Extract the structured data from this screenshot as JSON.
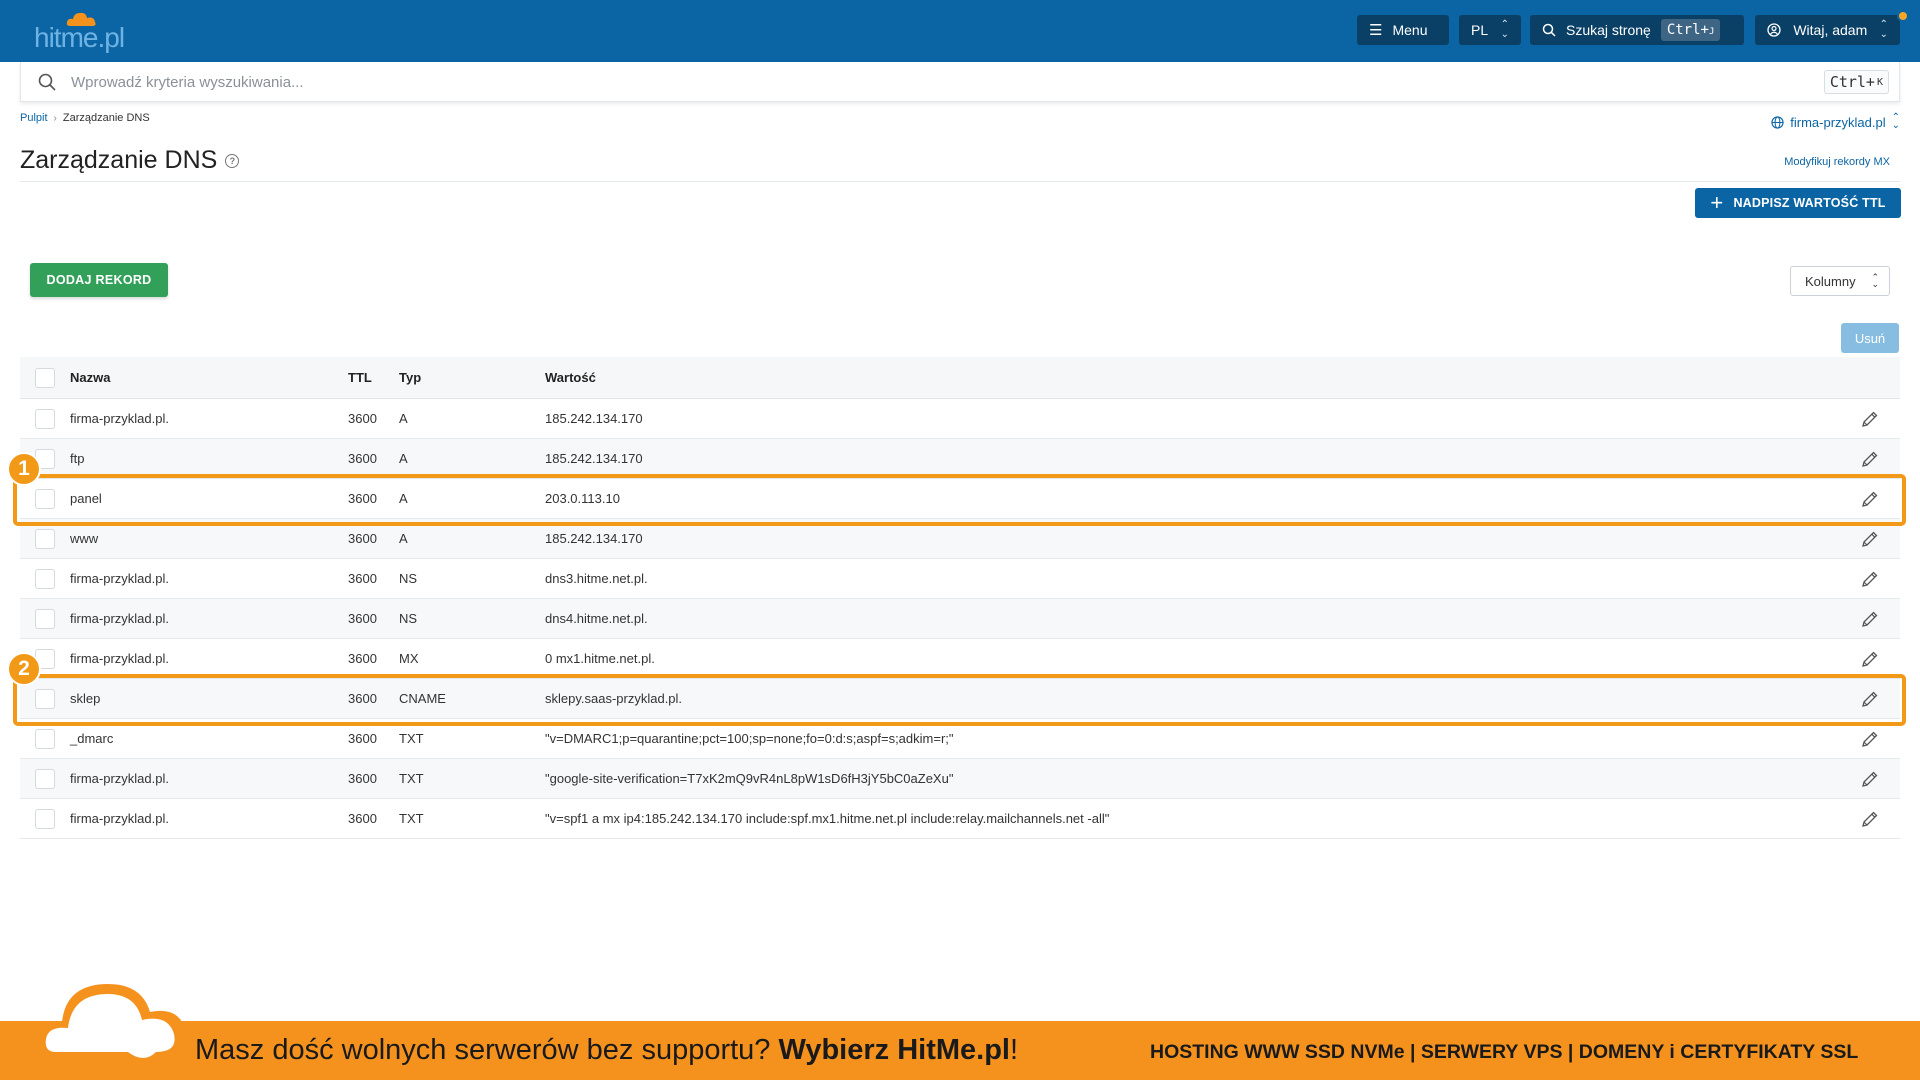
{
  "brand": {
    "logo_text": "hitme.pl"
  },
  "topbar": {
    "menu_label": "Menu",
    "lang": "PL",
    "search_label": "Szukaj stronę",
    "search_kbd": "Ctrl+",
    "search_kbd_key": "J",
    "user_label": "Witaj, adam"
  },
  "search": {
    "placeholder": "Wprowadź kryteria wyszukiwania...",
    "kbd": "Ctrl+",
    "kbd_key": "K"
  },
  "breadcrumb": {
    "home": "Pulpit",
    "current": "Zarządzanie DNS"
  },
  "domain": "firma-przyklad.pl",
  "page": {
    "title": "Zarządzanie DNS",
    "mx_link": "Modyfikuj rekordy MX",
    "ttl_button": "NADPISZ WARTOŚĆ TTL",
    "add_button": "DODAJ REKORD",
    "columns_button": "Kolumny",
    "delete_button": "Usuń"
  },
  "table": {
    "headers": {
      "name": "Nazwa",
      "ttl": "TTL",
      "type": "Typ",
      "value": "Wartość"
    },
    "rows": [
      {
        "name": "firma-przyklad.pl.",
        "ttl": "3600",
        "type": "A",
        "value": "185.242.134.170"
      },
      {
        "name": "ftp",
        "ttl": "3600",
        "type": "A",
        "value": "185.242.134.170"
      },
      {
        "name": "panel",
        "ttl": "3600",
        "type": "A",
        "value": "203.0.113.10"
      },
      {
        "name": "www",
        "ttl": "3600",
        "type": "A",
        "value": "185.242.134.170"
      },
      {
        "name": "firma-przyklad.pl.",
        "ttl": "3600",
        "type": "NS",
        "value": "dns3.hitme.net.pl."
      },
      {
        "name": "firma-przyklad.pl.",
        "ttl": "3600",
        "type": "NS",
        "value": "dns4.hitme.net.pl."
      },
      {
        "name": "firma-przyklad.pl.",
        "ttl": "3600",
        "type": "MX",
        "value": "0 mx1.hitme.net.pl."
      },
      {
        "name": "sklep",
        "ttl": "3600",
        "type": "CNAME",
        "value": "sklepy.saas-przyklad.pl."
      },
      {
        "name": "_dmarc",
        "ttl": "3600",
        "type": "TXT",
        "value": "\"v=DMARC1;p=quarantine;pct=100;sp=none;fo=0:d:s;aspf=s;adkim=r;\""
      },
      {
        "name": "firma-przyklad.pl.",
        "ttl": "3600",
        "type": "TXT",
        "value": "\"google-site-verification=T7xK2mQ9vR4nL8pW1sD6fH3jY5bC0aZeXu\""
      },
      {
        "name": "firma-przyklad.pl.",
        "ttl": "3600",
        "type": "TXT",
        "value": "\"v=spf1 a mx ip4:185.242.134.170 include:spf.mx1.hitme.net.pl include:relay.mailchannels.net -all\""
      }
    ]
  },
  "highlights": [
    {
      "label": "1",
      "row_index": 2
    },
    {
      "label": "2",
      "row_index": 7
    }
  ],
  "banner": {
    "text_regular": "Masz dość wolnych serwerów bez supportu? ",
    "text_bold": "Wybierz HitMe.pl",
    "text_end": "!",
    "right_text": "HOSTING WWW SSD NVMe | SERWERY VPS | DOMENY i CERTYFIKATY SSL"
  },
  "colors": {
    "topbar": "#0b64a3",
    "primary": "#0b64a3",
    "success": "#33a05a",
    "highlight": "#f29a17",
    "banner": "#f5921e"
  }
}
